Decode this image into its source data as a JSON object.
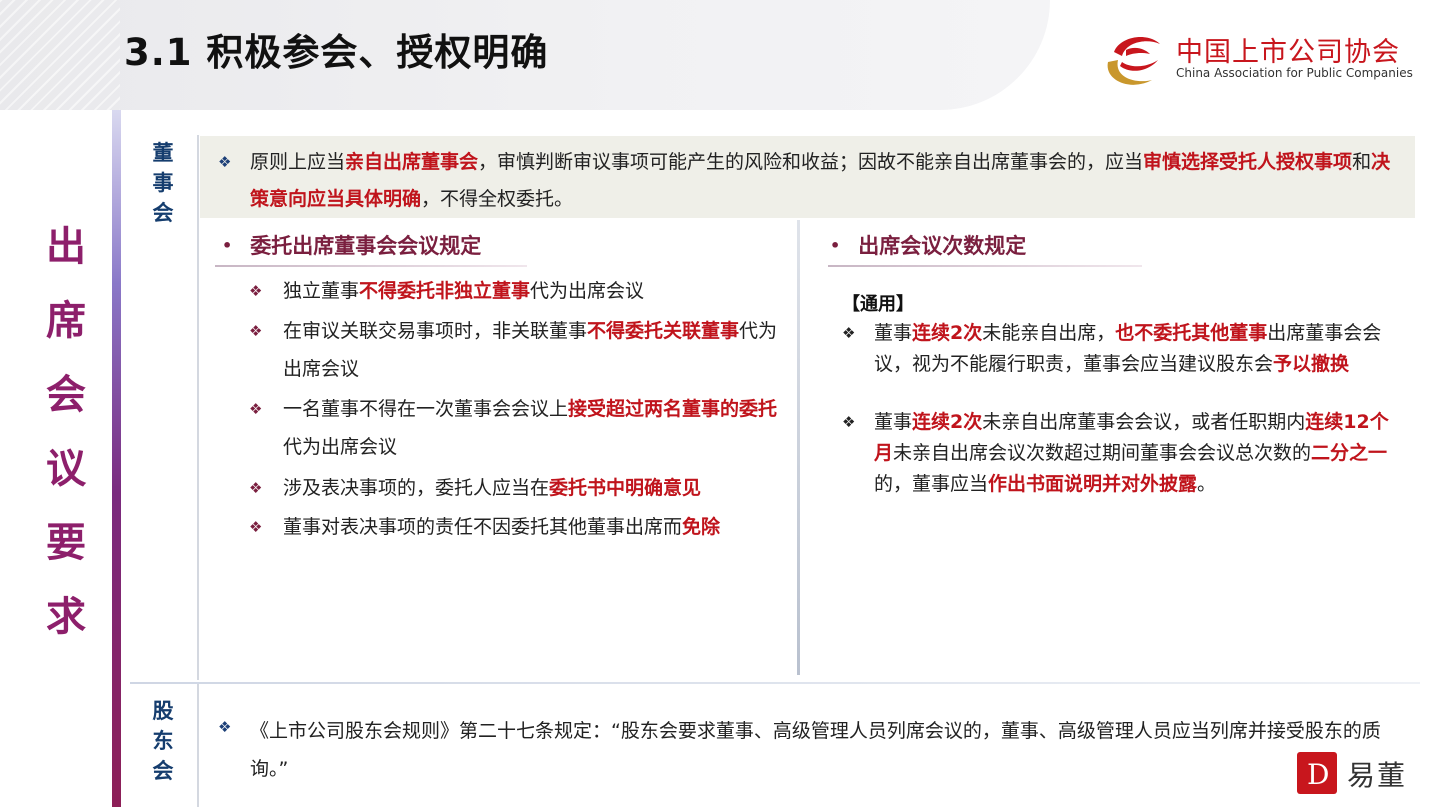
{
  "header": {
    "title": "3.1 积极参会、授权明确",
    "logo_cn": "中国上市公司协会",
    "logo_en": "China Association for Public Companies"
  },
  "sidebar": {
    "vertical_title": [
      "出",
      "席",
      "会",
      "议",
      "要",
      "求"
    ]
  },
  "board": {
    "label": [
      "董",
      "事",
      "会"
    ],
    "principle": {
      "p1": "原则上应当",
      "h1": "亲自出席董事会",
      "p2": "，审慎判断审议事项可能产生的风险和收益；因故不能亲自出席董事会的，应当",
      "h2": "审慎选择受托人授权事项",
      "p3": "和",
      "h3": "决策意向应当具体明确",
      "p4": "，不得全权委托。"
    },
    "left_section": {
      "heading": "委托出席董事会会议规定",
      "items": [
        {
          "a": "独立董事",
          "h": "不得委托非独立董事",
          "b": "代为出席会议"
        },
        {
          "a": "在审议关联交易事项时，非关联董事",
          "h": "不得委托关联董事",
          "b": "代为出席会议"
        },
        {
          "a": "一名董事不得在一次董事会会议上",
          "h": "接受超过两名董事的委托",
          "b": "代为出席会议"
        },
        {
          "a": "涉及表决事项的，委托人应当在",
          "h": "委托书中明确意见",
          "b": ""
        },
        {
          "a": "董事对表决事项的责任不因委托其他董事出席而",
          "h": "免除",
          "b": ""
        }
      ]
    },
    "right_section": {
      "heading": "出席会议次数规定",
      "tag": "【通用】",
      "items": [
        {
          "a": "董事",
          "h1": "连续2次",
          "b": "未能亲自出席，",
          "h2": "也不委托其他董事",
          "c": "出席董事会会议，视为不能履行职责，董事会应当建议股东会",
          "h3": "予以撤换",
          "d": ""
        },
        {
          "a": " 董事",
          "h1": "连续2次",
          "b": "未亲自出席董事会会议，或者任职期内",
          "h2": "连续12个月",
          "c": "未亲自出席会议次数超过期间董事会会议总次数的",
          "h3": "二分之一",
          "d": "的，董事应当",
          "h4": "作出书面说明并对外披露",
          "e": "。"
        }
      ]
    }
  },
  "shareholders": {
    "label": [
      "股",
      "东",
      "会"
    ],
    "text": "《上市公司股东会规则》第二十七条规定：“股东会要求董事、高级管理人员列席会议的，董事、高级管理人员应当列席并接受股东的质询。”"
  },
  "brand": {
    "mark": "D",
    "name": "易董"
  },
  "colors": {
    "highlight": "#c0141c",
    "title_purple": "#8d1f6b",
    "section_blue": "#153d6e"
  },
  "icons": {
    "bullet": "diamond-bullet-icon",
    "dot": "dot-bullet-icon"
  }
}
